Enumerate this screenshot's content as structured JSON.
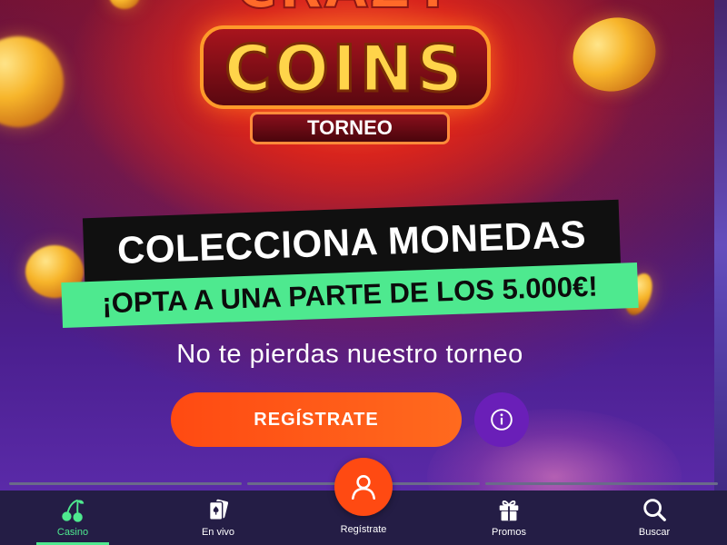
{
  "colors": {
    "accent_orange": "#ff4a12",
    "accent_green": "#4ee98f",
    "nav_background": "#241d45",
    "info_purple": "#6a1fb8"
  },
  "hero": {
    "logo_word_top": "CRAZY",
    "logo_word_main": "COINS",
    "logo_badge": "TORNEO",
    "headline": "COLECCIONA MONEDAS",
    "highlight": "¡OPTA A UNA PARTE DE LOS 5.000€!",
    "subtitle": "No te pierdas nuestro torneo",
    "cta_label": "REGÍSTRATE",
    "info_icon": "info-icon"
  },
  "nav": {
    "items": [
      {
        "label": "Casino",
        "icon": "cherries-icon",
        "active": true
      },
      {
        "label": "En vivo",
        "icon": "playing-cards-icon",
        "active": false
      },
      {
        "label": "Regístrate",
        "icon": "user-icon",
        "active": false
      },
      {
        "label": "Promos",
        "icon": "gift-icon",
        "active": false
      },
      {
        "label": "Buscar",
        "icon": "search-icon",
        "active": false
      }
    ]
  }
}
